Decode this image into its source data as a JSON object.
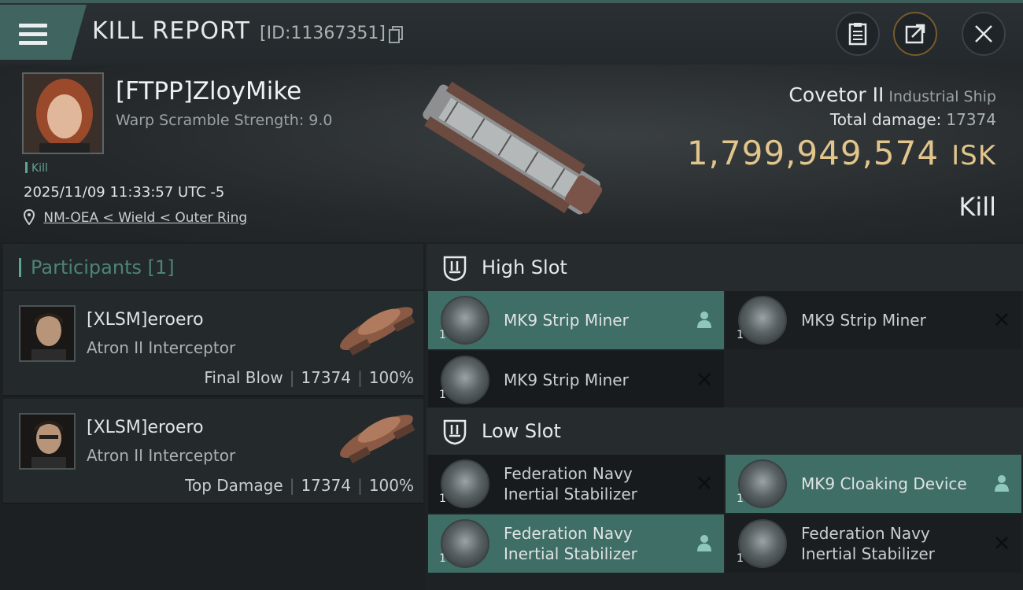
{
  "header": {
    "title": "KILL REPORT",
    "report_id": "[ID:11367351]"
  },
  "victim": {
    "name": "[FTPP]ZloyMike",
    "warp_scramble": "Warp Scramble Strength: 9.0",
    "tag": "Kill",
    "timestamp": "2025/11/09 11:33:57 UTC -5",
    "location": "NM-OEA < Wield < Outer Ring",
    "ship_name": "Covetor II",
    "ship_class": "Industrial Ship",
    "total_damage_label": "Total damage:",
    "total_damage_value": "17374",
    "isk_value": "1,799,949,574",
    "isk_unit": "ISK",
    "status": "Kill"
  },
  "participants": {
    "title": "Participants [1]",
    "rows": [
      {
        "name": "[XLSM]eroero",
        "ship": "Atron II Interceptor",
        "role": "Final Blow",
        "damage": "17374",
        "percent": "100%"
      },
      {
        "name": "[XLSM]eroero",
        "ship": "Atron II Interceptor",
        "role": "Top Damage",
        "damage": "17374",
        "percent": "100%"
      }
    ]
  },
  "slots": {
    "high": {
      "title": "High Slot",
      "modules": [
        {
          "name": "MK9 Strip Miner",
          "qty": "1",
          "status": "person-icon"
        },
        {
          "name": "MK9 Strip Miner",
          "qty": "1",
          "status": "destroyed-icon"
        },
        {
          "name": "MK9 Strip Miner",
          "qty": "1",
          "status": "destroyed-icon"
        }
      ]
    },
    "low": {
      "title": "Low Slot",
      "modules": [
        {
          "name_line1": "Federation Navy",
          "name_line2": "Inertial Stabilizer",
          "qty": "1",
          "status": "destroyed-icon"
        },
        {
          "name": "MK9 Cloaking Device",
          "qty": "1",
          "status": "person-icon"
        },
        {
          "name_line1": "Federation Navy",
          "name_line2": "Inertial Stabilizer",
          "qty": "1",
          "status": "person-icon"
        },
        {
          "name_line1": "Federation Navy",
          "name_line2": "Inertial Stabilizer",
          "qty": "1",
          "status": "destroyed-icon"
        }
      ]
    }
  }
}
